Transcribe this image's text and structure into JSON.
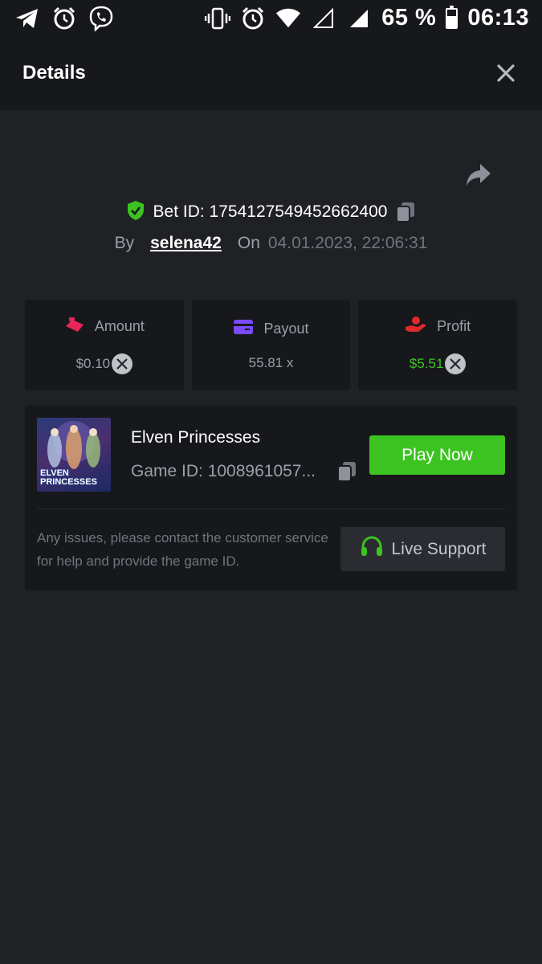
{
  "status_bar": {
    "battery": "65 %",
    "time": "06:13"
  },
  "header": {
    "title": "Details"
  },
  "bet": {
    "id_text": "Bet ID: 1754127549452662400",
    "by_label": "By",
    "username": "selena42",
    "on_label": "On",
    "date": "04.01.2023, 22:06:31"
  },
  "stats": [
    {
      "label": "Amount",
      "value": "$0.10",
      "icon": "amount-icon",
      "color": "#e8245a"
    },
    {
      "label": "Payout",
      "value": "55.81 x",
      "icon": "card-icon",
      "color": "#7b4bff"
    },
    {
      "label": "Profit",
      "value": "$5.51",
      "icon": "hand-coin-icon",
      "color": "#e02a2a"
    }
  ],
  "game": {
    "name": "Elven Princesses",
    "id_text": "Game ID: 1008961057...",
    "thumb_line1": "ELVEN",
    "thumb_line2": "PRINCESSES",
    "play_label": "Play Now",
    "help_text": "Any issues, please contact the customer service for help and provide the game ID.",
    "support_label": "Live Support"
  },
  "colors": {
    "accent_green": "#3cc321",
    "background": "#202125",
    "panel": "#17181b"
  }
}
